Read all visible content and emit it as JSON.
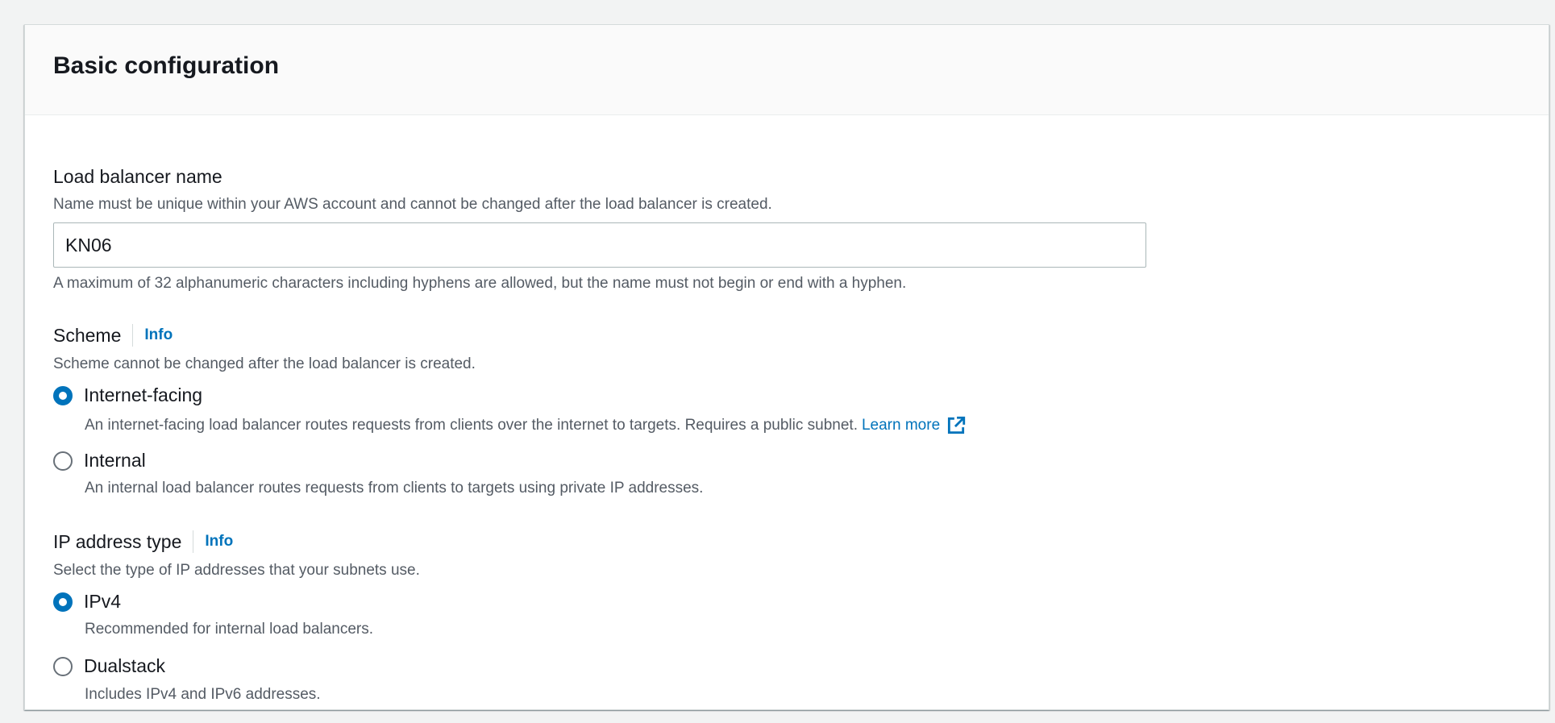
{
  "section": {
    "title": "Basic configuration"
  },
  "name_field": {
    "label": "Load balancer name",
    "description": "Name must be unique within your AWS account and cannot be changed after the load balancer is created.",
    "value": "KN06",
    "constraint": "A maximum of 32 alphanumeric characters including hyphens are allowed, but the name must not begin or end with a hyphen."
  },
  "scheme": {
    "label": "Scheme",
    "info": "Info",
    "description": "Scheme cannot be changed after the load balancer is created.",
    "options": [
      {
        "label": "Internet-facing",
        "description": "An internet-facing load balancer routes requests from clients over the internet to targets. Requires a public subnet.",
        "link": "Learn more",
        "link_icon": "external-link-icon",
        "selected": true
      },
      {
        "label": "Internal",
        "description": "An internal load balancer routes requests from clients to targets using private IP addresses.",
        "selected": false
      }
    ]
  },
  "ip_type": {
    "label": "IP address type",
    "info": "Info",
    "description": "Select the type of IP addresses that your subnets use.",
    "options": [
      {
        "label": "IPv4",
        "description": "Recommended for internal load balancers.",
        "selected": true
      },
      {
        "label": "Dualstack",
        "description": "Includes IPv4 and IPv6 addresses.",
        "selected": false
      }
    ]
  },
  "colors": {
    "accent": "#0073bb",
    "text": "#16191f",
    "secondary_text": "#545b64",
    "page_background": "#f2f3f3"
  }
}
